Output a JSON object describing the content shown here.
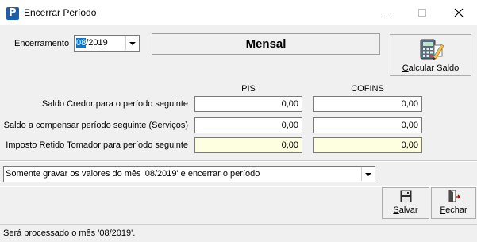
{
  "window": {
    "title": "Encerrar Período",
    "icon_letter": "P",
    "minimize_icon": "minimize-icon",
    "maximize_icon": "maximize-icon",
    "close_icon": "close-icon"
  },
  "encerramento": {
    "label": "Encerramento",
    "value_selected": "08",
    "value_rest": "/2019",
    "periodicity": "Mensal"
  },
  "calcular_button": {
    "label_underlined": "C",
    "label_rest": "alcular Saldo",
    "icon": "calculator-icon"
  },
  "columns": {
    "pis": "PIS",
    "cofins": "COFINS"
  },
  "rows": [
    {
      "label": "Saldo Credor para o período seguinte",
      "pis": "0,00",
      "cofins": "0,00",
      "readonly": false
    },
    {
      "label": "Saldo a compensar período seguinte (Serviços)",
      "pis": "0,00",
      "cofins": "0,00",
      "readonly": false
    },
    {
      "label": "Imposto Retido Tomador para período seguinte",
      "pis": "0,00",
      "cofins": "0,00",
      "readonly": true
    }
  ],
  "action_select": {
    "value": "Somente gravar os valores do mês '08/2019' e encerrar o período"
  },
  "salvar_button": {
    "label_underlined": "S",
    "label_rest": "alvar",
    "icon": "floppy-disk-icon"
  },
  "fechar_button": {
    "label_underlined": "F",
    "label_rest": "echar",
    "icon": "exit-door-icon"
  },
  "status": {
    "text": "Será processado o mês '08/2019'."
  },
  "colors": {
    "readonly_field": "#fefee0",
    "selection": "#0078d7",
    "window_bg": "#f0f0f0"
  }
}
